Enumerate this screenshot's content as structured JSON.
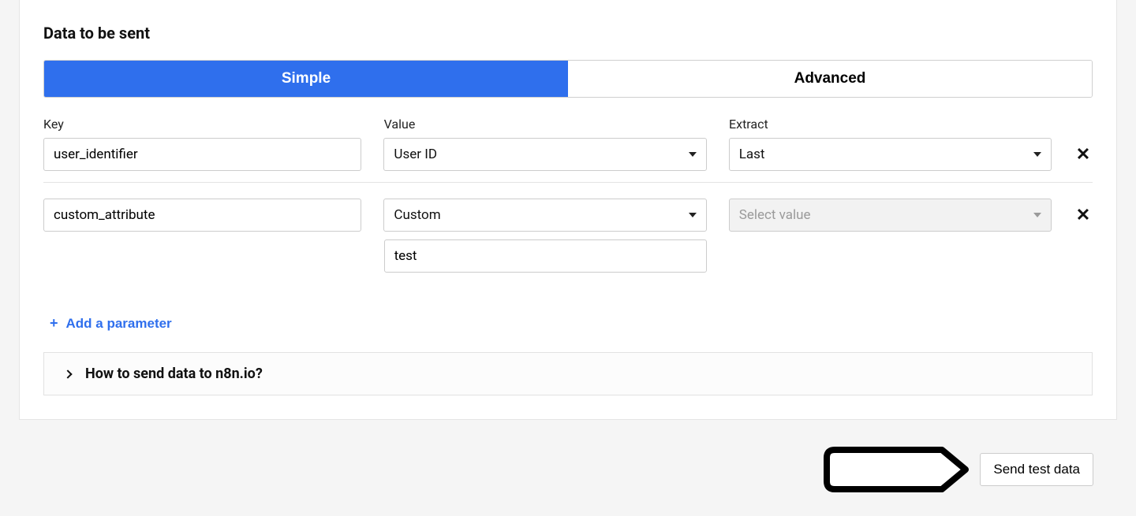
{
  "section_title": "Data to be sent",
  "tabs": {
    "simple": "Simple",
    "advanced": "Advanced"
  },
  "columns": {
    "key": "Key",
    "value": "Value",
    "extract": "Extract"
  },
  "rows": [
    {
      "key": "user_identifier",
      "value_select": "User ID",
      "extract_select": "Last",
      "custom_value": ""
    },
    {
      "key": "custom_attribute",
      "value_select": "Custom",
      "extract_placeholder": "Select value",
      "custom_value": "test"
    }
  ],
  "add_parameter_label": "Add a parameter",
  "accordion_title": "How to send data to n8n.io?",
  "send_button_label": "Send test data"
}
